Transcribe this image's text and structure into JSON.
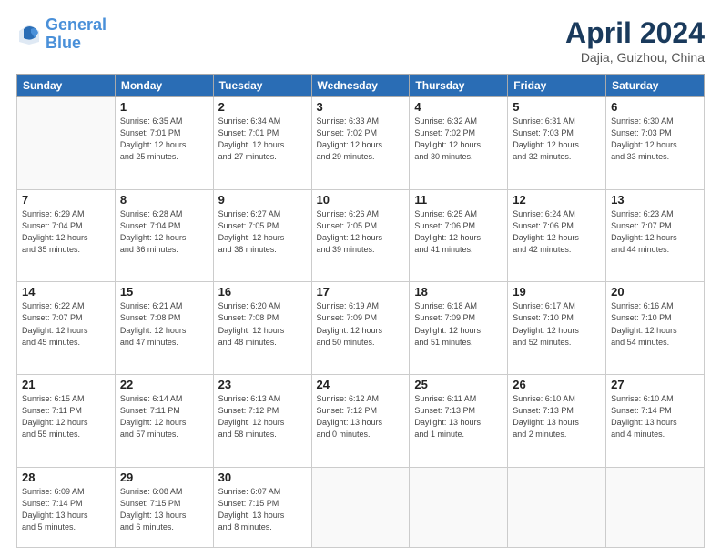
{
  "header": {
    "logo_line1": "General",
    "logo_line2": "Blue",
    "month": "April 2024",
    "location": "Dajia, Guizhou, China"
  },
  "weekdays": [
    "Sunday",
    "Monday",
    "Tuesday",
    "Wednesday",
    "Thursday",
    "Friday",
    "Saturday"
  ],
  "weeks": [
    [
      {
        "day": "",
        "info": ""
      },
      {
        "day": "1",
        "info": "Sunrise: 6:35 AM\nSunset: 7:01 PM\nDaylight: 12 hours\nand 25 minutes."
      },
      {
        "day": "2",
        "info": "Sunrise: 6:34 AM\nSunset: 7:01 PM\nDaylight: 12 hours\nand 27 minutes."
      },
      {
        "day": "3",
        "info": "Sunrise: 6:33 AM\nSunset: 7:02 PM\nDaylight: 12 hours\nand 29 minutes."
      },
      {
        "day": "4",
        "info": "Sunrise: 6:32 AM\nSunset: 7:02 PM\nDaylight: 12 hours\nand 30 minutes."
      },
      {
        "day": "5",
        "info": "Sunrise: 6:31 AM\nSunset: 7:03 PM\nDaylight: 12 hours\nand 32 minutes."
      },
      {
        "day": "6",
        "info": "Sunrise: 6:30 AM\nSunset: 7:03 PM\nDaylight: 12 hours\nand 33 minutes."
      }
    ],
    [
      {
        "day": "7",
        "info": "Sunrise: 6:29 AM\nSunset: 7:04 PM\nDaylight: 12 hours\nand 35 minutes."
      },
      {
        "day": "8",
        "info": "Sunrise: 6:28 AM\nSunset: 7:04 PM\nDaylight: 12 hours\nand 36 minutes."
      },
      {
        "day": "9",
        "info": "Sunrise: 6:27 AM\nSunset: 7:05 PM\nDaylight: 12 hours\nand 38 minutes."
      },
      {
        "day": "10",
        "info": "Sunrise: 6:26 AM\nSunset: 7:05 PM\nDaylight: 12 hours\nand 39 minutes."
      },
      {
        "day": "11",
        "info": "Sunrise: 6:25 AM\nSunset: 7:06 PM\nDaylight: 12 hours\nand 41 minutes."
      },
      {
        "day": "12",
        "info": "Sunrise: 6:24 AM\nSunset: 7:06 PM\nDaylight: 12 hours\nand 42 minutes."
      },
      {
        "day": "13",
        "info": "Sunrise: 6:23 AM\nSunset: 7:07 PM\nDaylight: 12 hours\nand 44 minutes."
      }
    ],
    [
      {
        "day": "14",
        "info": "Sunrise: 6:22 AM\nSunset: 7:07 PM\nDaylight: 12 hours\nand 45 minutes."
      },
      {
        "day": "15",
        "info": "Sunrise: 6:21 AM\nSunset: 7:08 PM\nDaylight: 12 hours\nand 47 minutes."
      },
      {
        "day": "16",
        "info": "Sunrise: 6:20 AM\nSunset: 7:08 PM\nDaylight: 12 hours\nand 48 minutes."
      },
      {
        "day": "17",
        "info": "Sunrise: 6:19 AM\nSunset: 7:09 PM\nDaylight: 12 hours\nand 50 minutes."
      },
      {
        "day": "18",
        "info": "Sunrise: 6:18 AM\nSunset: 7:09 PM\nDaylight: 12 hours\nand 51 minutes."
      },
      {
        "day": "19",
        "info": "Sunrise: 6:17 AM\nSunset: 7:10 PM\nDaylight: 12 hours\nand 52 minutes."
      },
      {
        "day": "20",
        "info": "Sunrise: 6:16 AM\nSunset: 7:10 PM\nDaylight: 12 hours\nand 54 minutes."
      }
    ],
    [
      {
        "day": "21",
        "info": "Sunrise: 6:15 AM\nSunset: 7:11 PM\nDaylight: 12 hours\nand 55 minutes."
      },
      {
        "day": "22",
        "info": "Sunrise: 6:14 AM\nSunset: 7:11 PM\nDaylight: 12 hours\nand 57 minutes."
      },
      {
        "day": "23",
        "info": "Sunrise: 6:13 AM\nSunset: 7:12 PM\nDaylight: 12 hours\nand 58 minutes."
      },
      {
        "day": "24",
        "info": "Sunrise: 6:12 AM\nSunset: 7:12 PM\nDaylight: 13 hours\nand 0 minutes."
      },
      {
        "day": "25",
        "info": "Sunrise: 6:11 AM\nSunset: 7:13 PM\nDaylight: 13 hours\nand 1 minute."
      },
      {
        "day": "26",
        "info": "Sunrise: 6:10 AM\nSunset: 7:13 PM\nDaylight: 13 hours\nand 2 minutes."
      },
      {
        "day": "27",
        "info": "Sunrise: 6:10 AM\nSunset: 7:14 PM\nDaylight: 13 hours\nand 4 minutes."
      }
    ],
    [
      {
        "day": "28",
        "info": "Sunrise: 6:09 AM\nSunset: 7:14 PM\nDaylight: 13 hours\nand 5 minutes."
      },
      {
        "day": "29",
        "info": "Sunrise: 6:08 AM\nSunset: 7:15 PM\nDaylight: 13 hours\nand 6 minutes."
      },
      {
        "day": "30",
        "info": "Sunrise: 6:07 AM\nSunset: 7:15 PM\nDaylight: 13 hours\nand 8 minutes."
      },
      {
        "day": "",
        "info": ""
      },
      {
        "day": "",
        "info": ""
      },
      {
        "day": "",
        "info": ""
      },
      {
        "day": "",
        "info": ""
      }
    ]
  ]
}
